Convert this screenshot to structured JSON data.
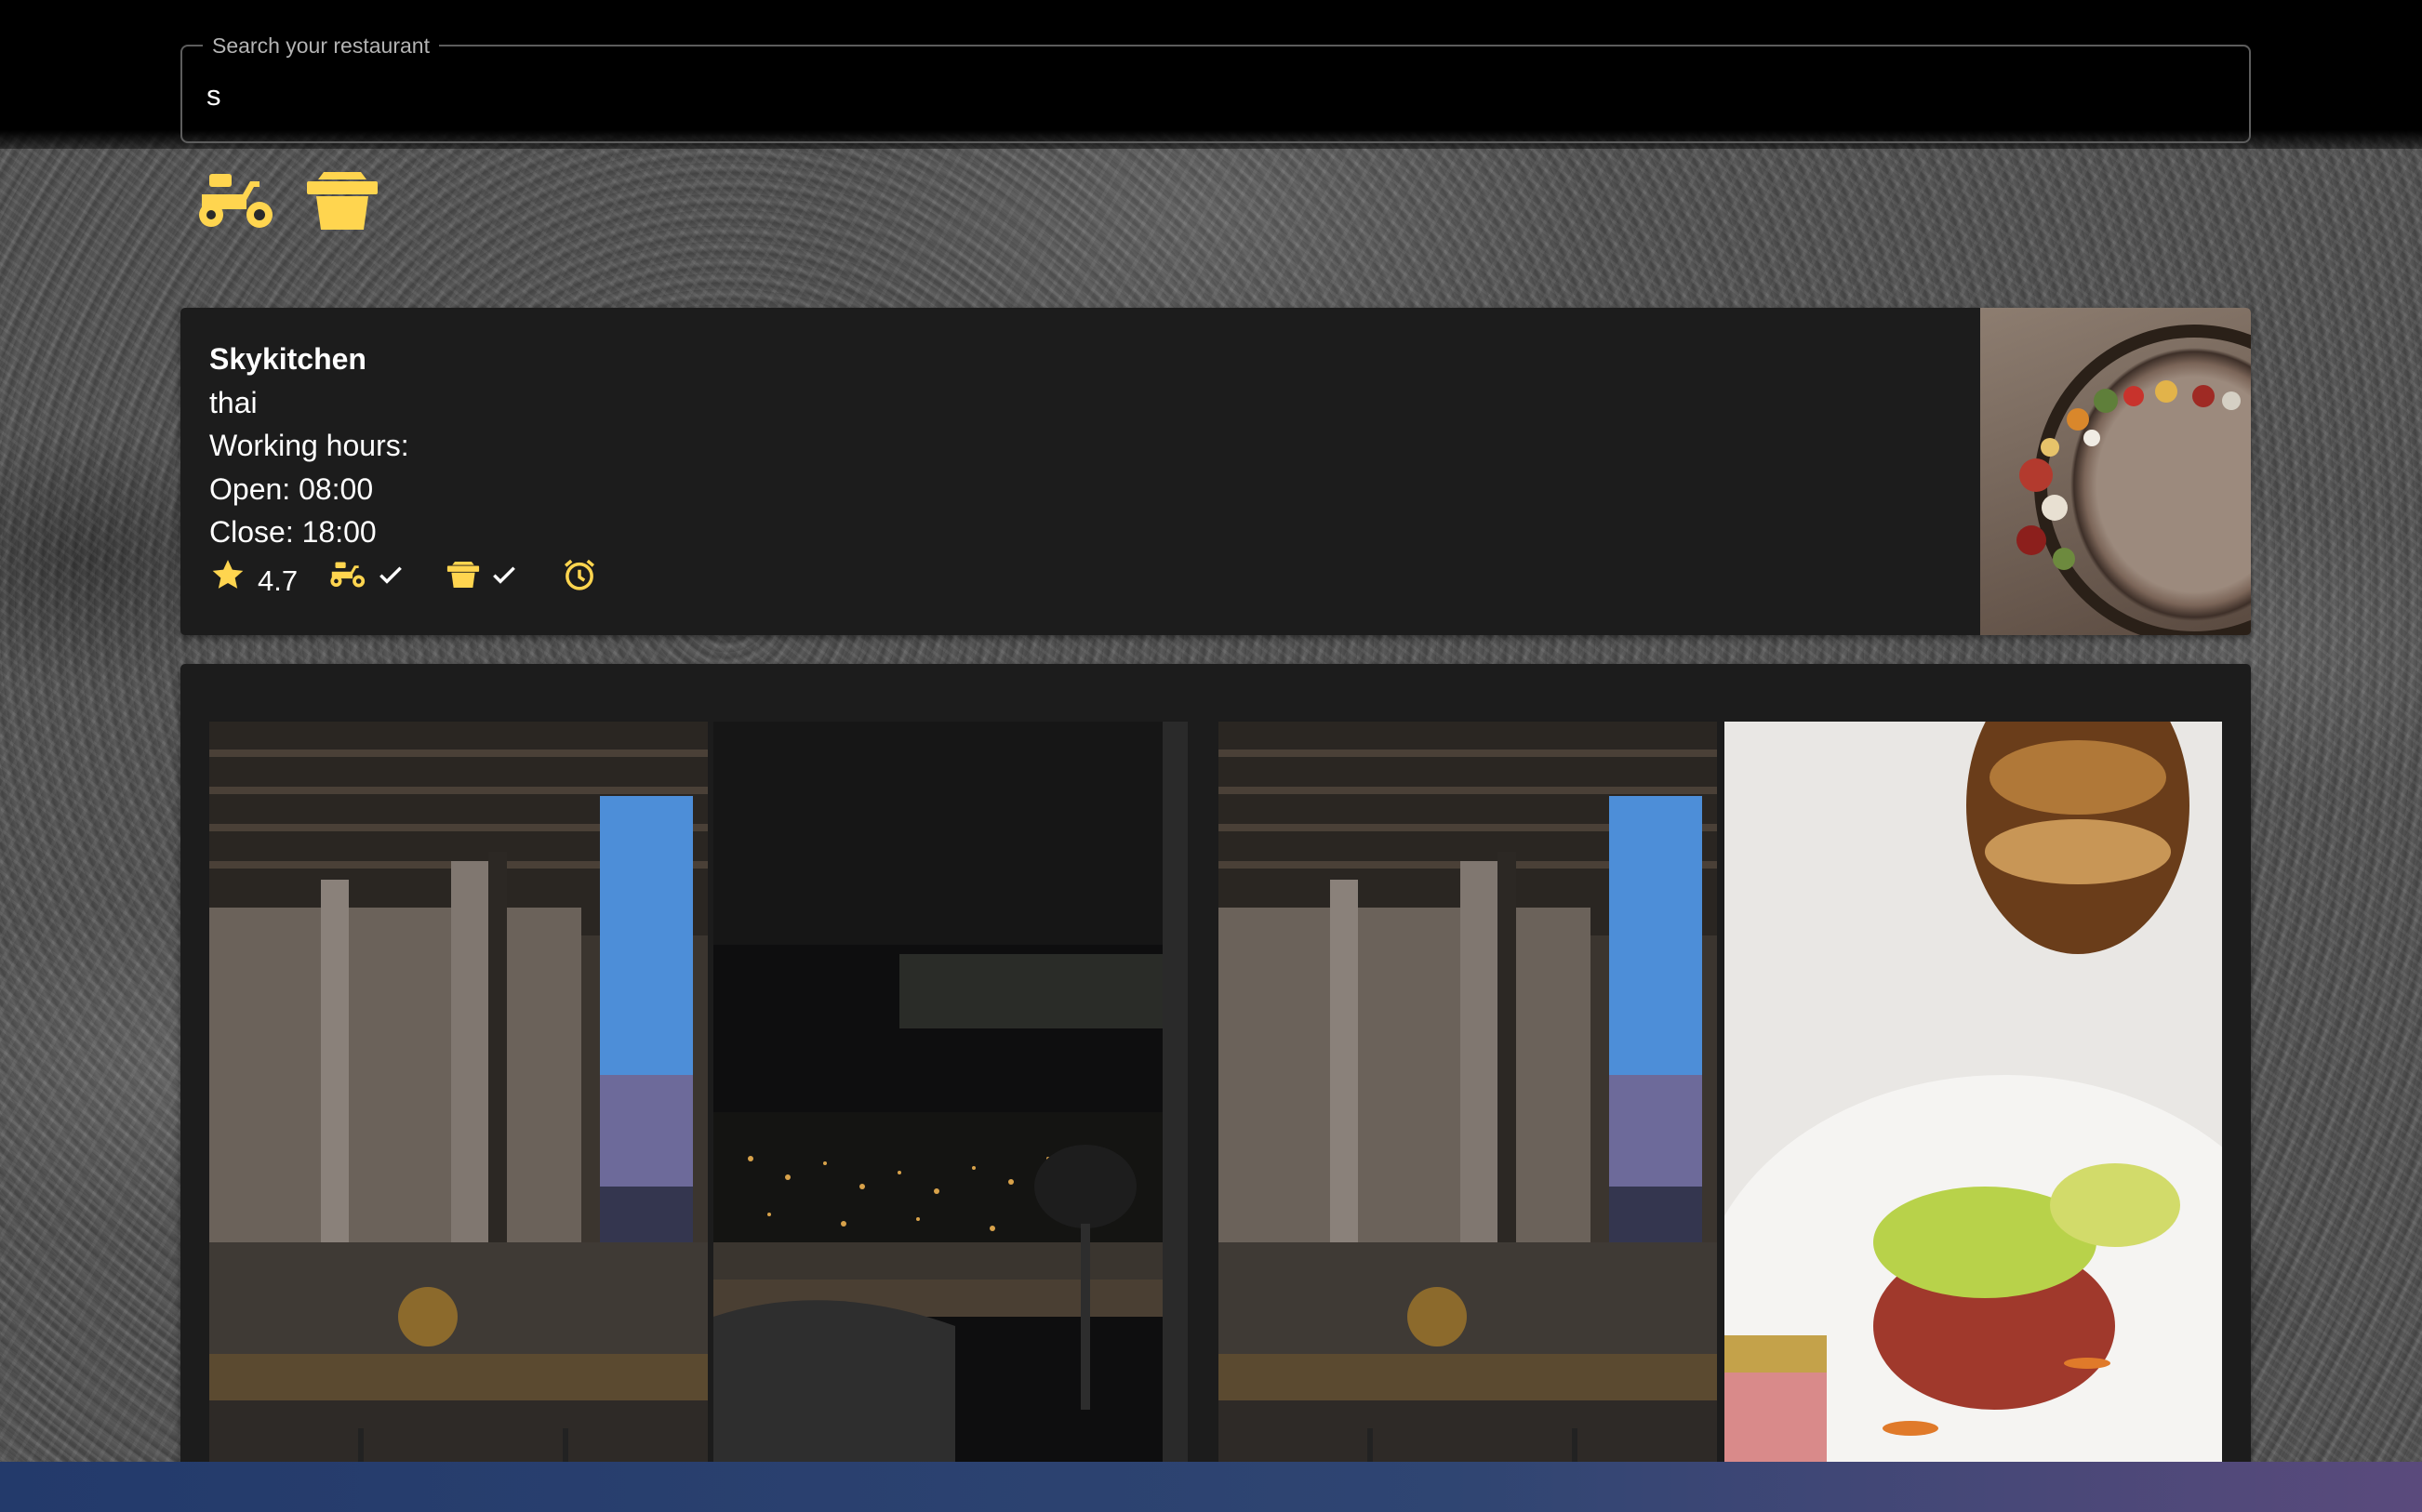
{
  "search": {
    "label": "Search your restaurant",
    "value": "s"
  },
  "filters": [
    {
      "icon": "scooter-icon",
      "label": "delivery"
    },
    {
      "icon": "takeaway-bag-icon",
      "label": "takeaway"
    }
  ],
  "restaurant": {
    "name": "Skykitchen",
    "cuisine": "thai",
    "working_hours_label": "Working hours:",
    "open": "Open: 08:00",
    "close": "Close: 18:00",
    "rating": "4.7",
    "delivery": true,
    "takeaway": true
  },
  "colors": {
    "accent": "#FFD54F",
    "card_bg": "#1c1c1c",
    "text": "#ffffff"
  },
  "gallery": {
    "photos": [
      "restaurant-interior-window",
      "restaurant-night-view",
      "restaurant-interior-window",
      "plated-tuna-dish"
    ]
  }
}
